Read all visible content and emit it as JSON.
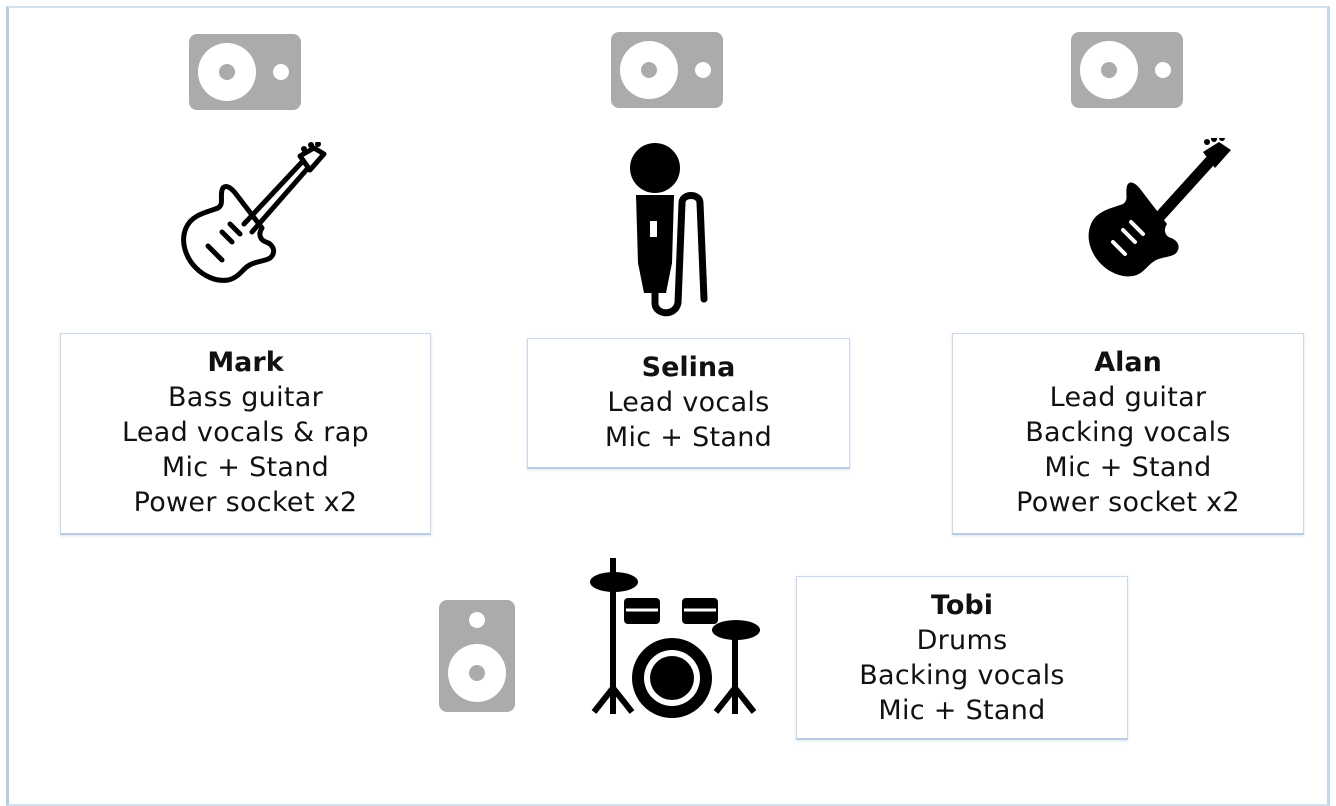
{
  "colors": {
    "speaker": "#ababab",
    "icon": "#000000",
    "card_border": "#c9d8ea"
  },
  "icons": {
    "monitor": "speaker-monitor-icon",
    "bass": "bass-guitar-icon",
    "mic": "microphone-icon",
    "lead": "electric-guitar-icon",
    "drums": "drum-kit-icon",
    "drum_monitor": "speaker-icon"
  },
  "members": {
    "mark": {
      "name": "Mark",
      "lines": [
        "Bass guitar",
        "Lead vocals & rap",
        "Mic + Stand",
        "Power socket x2"
      ]
    },
    "selina": {
      "name": "Selina",
      "lines": [
        "Lead vocals",
        "Mic + Stand"
      ]
    },
    "alan": {
      "name": "Alan",
      "lines": [
        "Lead guitar",
        "Backing vocals",
        "Mic + Stand",
        "Power socket x2"
      ]
    },
    "tobi": {
      "name": "Tobi",
      "lines": [
        "Drums",
        "Backing vocals",
        "Mic + Stand"
      ]
    }
  }
}
